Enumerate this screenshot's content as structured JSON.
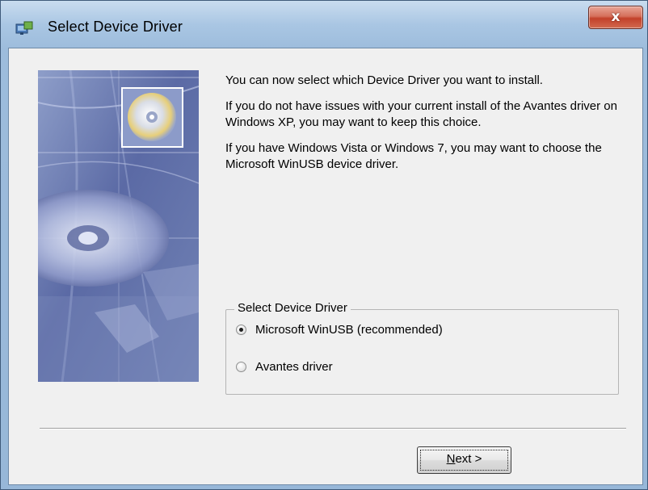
{
  "window": {
    "title": "Select Device Driver",
    "close_label": "x",
    "app_icon": "installer-icon"
  },
  "image": {
    "name": "cd-rom-banner-image"
  },
  "intro": {
    "line1": "You can now select which Device Driver you want to install.",
    "line2": "If you do not have issues with your current install of the Avantes driver on Windows XP, you may want to keep this choice.",
    "line3": "If you have Windows Vista or Windows 7, you may want to choose the Microsoft WinUSB device driver."
  },
  "group": {
    "title": "Select Device Driver",
    "options": [
      {
        "label": "Microsoft WinUSB (recommended)",
        "selected": true
      },
      {
        "label": "Avantes driver",
        "selected": false
      }
    ]
  },
  "buttons": {
    "next_prefix": "N",
    "next_rest": "ext >"
  }
}
